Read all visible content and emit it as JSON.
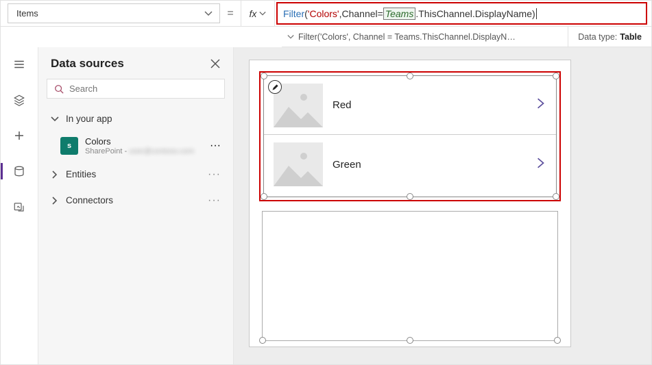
{
  "property_bar": {
    "property_name": "Items",
    "equals": "=",
    "fx_label": "fx",
    "formula_tokens": {
      "fn": "Filter",
      "open": "(",
      "str": "'Colors'",
      "comma1": ", ",
      "field": "Channel",
      "eq": " = ",
      "teams": "Teams",
      "rest": ".ThisChannel.DisplayName",
      "close": ")"
    }
  },
  "info_bar": {
    "summary": "Filter('Colors', Channel = Teams.ThisChannel.DisplayN…",
    "datatype_label": "Data type:",
    "datatype_value": "Table"
  },
  "left_panel": {
    "title": "Data sources",
    "search_placeholder": "Search",
    "sections": {
      "in_app": "In your app",
      "entities": "Entities",
      "connectors": "Connectors"
    },
    "datasource": {
      "name": "Colors",
      "subtype_prefix": "SharePoint - ",
      "subtype_hidden": "user@contoso.com"
    }
  },
  "gallery": {
    "items": [
      {
        "title": "Red"
      },
      {
        "title": "Green"
      }
    ]
  }
}
